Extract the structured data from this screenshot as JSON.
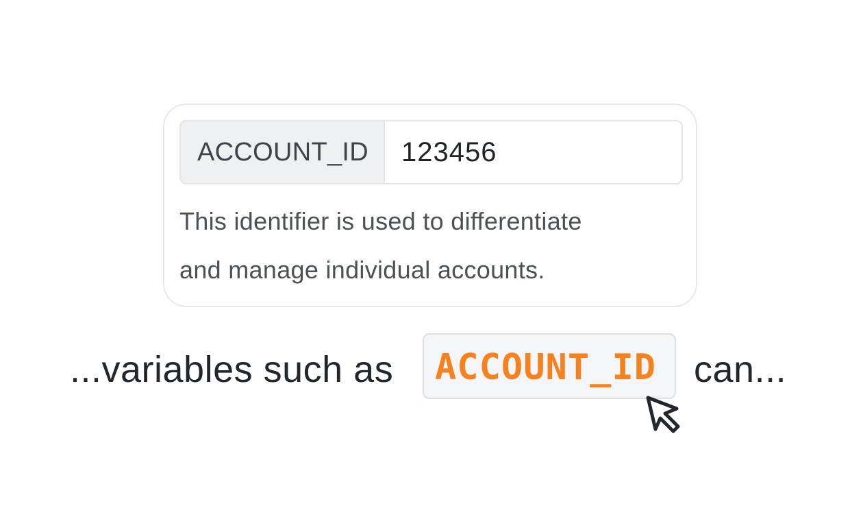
{
  "variable_field": {
    "label": "ACCOUNT_ID",
    "value": "123456"
  },
  "description": {
    "line1": "This identifier is used to differentiate",
    "line2": "and manage individual accounts."
  },
  "sentence": {
    "prefix": "...variables such as",
    "variable": "ACCOUNT_ID",
    "suffix": "can..."
  },
  "icons": {
    "cursor": "mouse-pointer-icon"
  },
  "colors": {
    "variable_accent": "#f6821f",
    "chip_background": "#f3f5f7",
    "label_background": "#eef0f2"
  }
}
